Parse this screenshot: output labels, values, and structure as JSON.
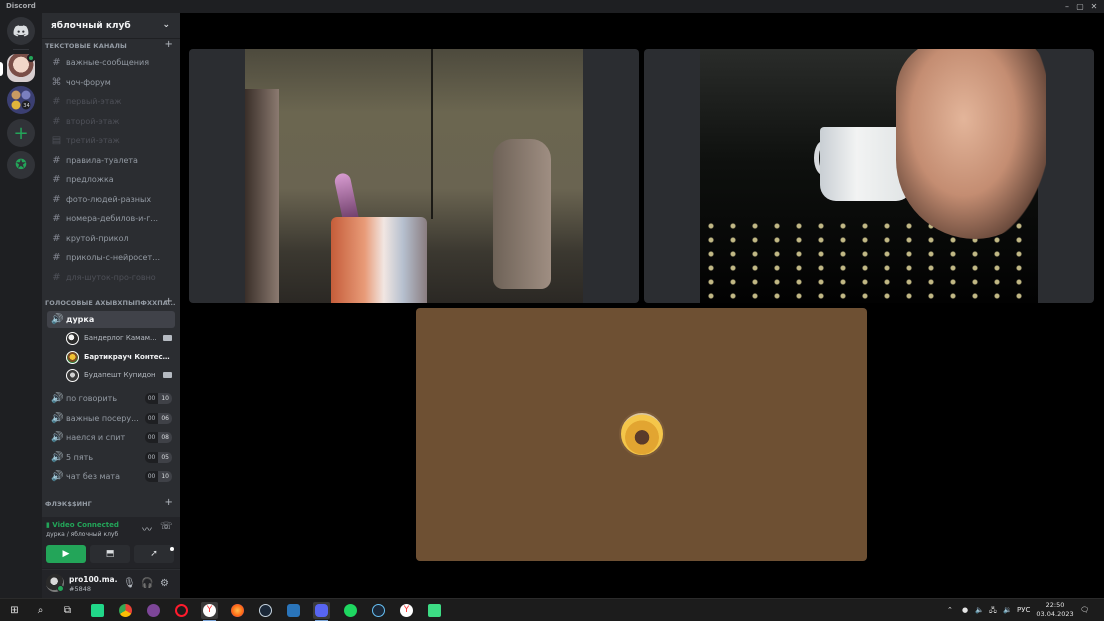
{
  "window": {
    "title": "Discord"
  },
  "guild": {
    "name": "яблочный клуб"
  },
  "categories": {
    "text": "ТЕКСТОВЫЕ КАНАЛЫ",
    "voice": "ГОЛОСОВЫЕ АХЫВХПЫПФХХПА...",
    "flex": "ФЛЭК$$ИНГ"
  },
  "text_channels": [
    {
      "label": "важные-сообщения",
      "icon": "hash-icon",
      "muted": false
    },
    {
      "label": "чоч-форум",
      "icon": "forum-icon",
      "muted": false
    },
    {
      "label": "первый-этаж",
      "icon": "hash-icon",
      "muted": true
    },
    {
      "label": "второй-этаж",
      "icon": "hash-icon",
      "muted": true
    },
    {
      "label": "третий-этаж",
      "icon": "rules-icon",
      "muted": true
    },
    {
      "label": "правила-туалета",
      "icon": "hash-icon",
      "muted": false
    },
    {
      "label": "предложка",
      "icon": "hash-icon",
      "muted": false
    },
    {
      "label": "фото-людей-разных",
      "icon": "hash-icon",
      "muted": false
    },
    {
      "label": "номера-дебилов-и-г...",
      "icon": "hash-icon",
      "muted": false
    },
    {
      "label": "крутой-прикол",
      "icon": "hash-icon",
      "muted": false
    },
    {
      "label": "приколы-с-нейросетя...",
      "icon": "hash-icon",
      "muted": false
    },
    {
      "label": "для-шуток-про-говно",
      "icon": "hash-icon",
      "muted": true
    }
  ],
  "active_voice_channel": {
    "label": "дурка",
    "users": [
      {
        "name": "Бандерлог Камам...",
        "camera": true,
        "bright": false
      },
      {
        "name": "Бартикрауч Контестр...",
        "camera": false,
        "bright": true
      },
      {
        "name": "Будапешт Купидон",
        "camera": true,
        "bright": false
      }
    ]
  },
  "voice_channels": [
    {
      "label": "по говорить",
      "count_a": "00",
      "count_b": "10"
    },
    {
      "label": "важные посеру...",
      "count_a": "00",
      "count_b": "06"
    },
    {
      "label": "наелся и спит",
      "count_a": "00",
      "count_b": "08"
    },
    {
      "label": "5 пять",
      "count_a": "00",
      "count_b": "05"
    },
    {
      "label": "чат без мата",
      "count_a": "00",
      "count_b": "10"
    }
  ],
  "voice_panel": {
    "status": "Video Connected",
    "location": "дурка / яблочный клуб"
  },
  "user": {
    "name": "pro100.ma...",
    "tag": "#5848"
  },
  "taskbar": {
    "language": "РУС",
    "time": "22:50",
    "date": "03.04.2023"
  },
  "colors": {
    "accent_green": "#23a559",
    "sidebar_bg": "#2b2d31",
    "rail_bg": "#1e1f22",
    "avatar_tile_bg": "#6e5033"
  }
}
